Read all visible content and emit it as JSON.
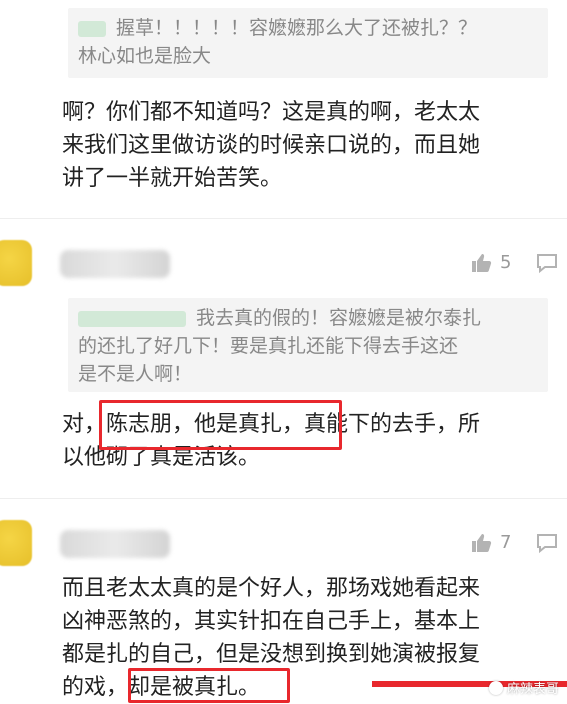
{
  "comment1": {
    "quote_line1": "握草！！！！！容嬷嬷那么大了还被扎？？",
    "quote_line2": "林心如也是脸大",
    "body_lines": [
      "啊？你们都不知道吗？这是真的啊，老太太",
      "来我们这里做访谈的时候亲口说的，而且她",
      "讲了一半就开始苦笑。"
    ]
  },
  "comment2": {
    "likes": "5",
    "quote_line1": "我去真的假的！容嬷嬷是被尔泰扎",
    "quote_line2": "的还扎了好几下！要是真扎还能下得去手这还",
    "quote_line3": "是不是人啊！",
    "body_prefix": "对，",
    "body_highlight": "陈志朋，他是真扎",
    "body_suffix": "，真能下的去手，所",
    "body_line2": "以他砌了真是活该。"
  },
  "comment3": {
    "likes": "7",
    "body_lines": [
      "而且老太太真的是个好人，那场戏她看起来",
      "凶神恶煞的，其实针扣在自己手上，基本上",
      "都是扎的自己，但是没想到换到她演被报复"
    ],
    "body_line4_prefix": "的戏，",
    "body_line4_highlight": "却是被真扎。"
  },
  "watermark": "麻辣表哥",
  "colors": {
    "highlight": "#e8282d",
    "quote_bg": "#f4f4f4",
    "avatar": "#f0cf3c"
  }
}
